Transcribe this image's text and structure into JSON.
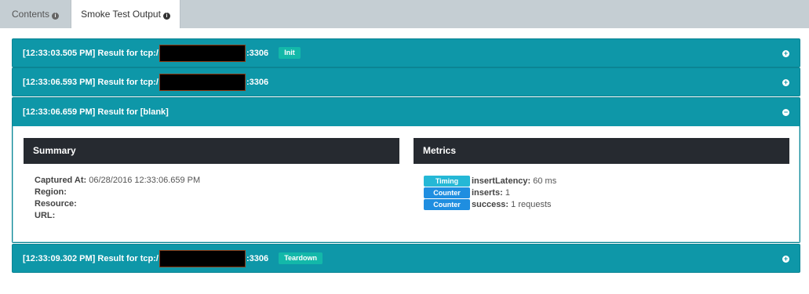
{
  "tabs": [
    {
      "label": "Contents"
    },
    {
      "label": "Smoke Test Output"
    }
  ],
  "results": [
    {
      "prefix": "[12:33:03.505 PM] Result for tcp:/",
      "port": ":3306",
      "badge": "Init",
      "toggle": "+"
    },
    {
      "prefix": "[12:33:06.593 PM] Result for tcp:/",
      "port": ":3306",
      "toggle": "+"
    },
    {
      "title": "[12:33:06.659 PM] Result for [blank]",
      "toggle": "−"
    },
    {
      "prefix": "[12:33:09.302 PM] Result for tcp:/",
      "port": ":3306",
      "badge": "Teardown",
      "toggle": "+"
    }
  ],
  "summary": {
    "heading": "Summary",
    "fields": [
      {
        "label": "Captured At:",
        "value": "06/28/2016 12:33:06.659 PM"
      },
      {
        "label": "Region:",
        "value": ""
      },
      {
        "label": "Resource:",
        "value": ""
      },
      {
        "label": "URL:",
        "value": ""
      }
    ]
  },
  "metrics": {
    "heading": "Metrics",
    "items": [
      {
        "type": "Timing",
        "name": "insertLatency:",
        "value": "60 ms"
      },
      {
        "type": "Counter",
        "name": "inserts:",
        "value": "1"
      },
      {
        "type": "Counter",
        "name": "success:",
        "value": "1 requests"
      }
    ]
  },
  "colors": {
    "panel": "#0e97a8",
    "box_header": "#262a30",
    "badge": "#13b8a9",
    "timing": "#25b8d6",
    "counter": "#1f8ee0"
  }
}
